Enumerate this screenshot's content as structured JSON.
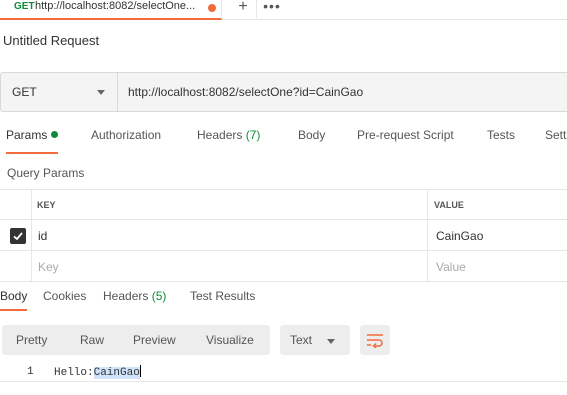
{
  "request_tab": {
    "method": "GET",
    "title": "http://localhost:8082/selectOne..."
  },
  "request_title": "Untitled Request",
  "url_bar": {
    "method": "GET",
    "url": "http://localhost:8082/selectOne?id=CainGao"
  },
  "param_tabs": [
    {
      "label": "Params",
      "count": ""
    },
    {
      "label": "Authorization",
      "count": ""
    },
    {
      "label": "Headers",
      "count": "(7)"
    },
    {
      "label": "Body",
      "count": ""
    },
    {
      "label": "Pre-request Script",
      "count": ""
    },
    {
      "label": "Tests",
      "count": ""
    },
    {
      "label": "Sett",
      "count": ""
    }
  ],
  "query_params": {
    "title": "Query Params",
    "headers": {
      "key": "KEY",
      "value": "VALUE"
    },
    "rows": [
      {
        "key": "id",
        "value": "CainGao",
        "checked": true
      }
    ],
    "placeholder": {
      "key": "Key",
      "value": "Value"
    }
  },
  "response_tabs": [
    {
      "label": "Body",
      "count": ""
    },
    {
      "label": "Cookies",
      "count": ""
    },
    {
      "label": "Headers",
      "count": "(5)"
    },
    {
      "label": "Test Results",
      "count": ""
    }
  ],
  "body_formats": [
    "Pretty",
    "Raw",
    "Preview",
    "Visualize"
  ],
  "body_type": "Text",
  "response_body": {
    "line_number": "1",
    "text_prefix": "Hello:",
    "text_selected": "CainGao"
  },
  "colors": {
    "accent": "#f26b3a",
    "success": "#0f8a3a"
  },
  "icons": {
    "add": "plus-icon",
    "more": "more-icon",
    "wrap": "wrap-lines-icon",
    "check": "check-icon"
  }
}
